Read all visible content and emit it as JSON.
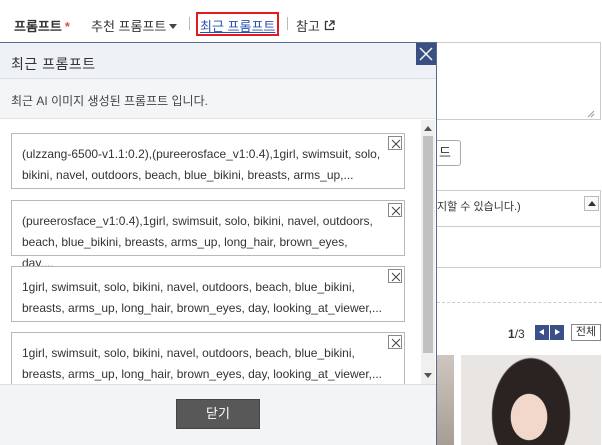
{
  "tabs": {
    "prompt": "프롬프트",
    "required_mark": "*",
    "recommended": "추천 프롬프트",
    "recent": "최근 프롬프트",
    "reference": "참고"
  },
  "background": {
    "button_label": "드",
    "notice_text": "지할 수 있습니다.)",
    "pager_current": "1",
    "pager_total": "/3",
    "all_label": "전체"
  },
  "modal": {
    "title": "최근 프롬프트",
    "description": "최근 AI 이미지 생성된 프롬프트 입니다.",
    "items": [
      {
        "text": "(ulzzang-6500-v1.1:0.2),(pureerosface_v1:0.4),1girl, swimsuit, solo, bikini, navel, outdoors, beach, blue_bikini, breasts, arms_up,..."
      },
      {
        "text": "(pureerosface_v1:0.4),1girl, swimsuit, solo, bikini, navel, outdoors, beach, blue_bikini, breasts, arms_up, long_hair, brown_eyes, day,..."
      },
      {
        "text": "1girl, swimsuit, solo, bikini, navel, outdoors, beach, blue_bikini, breasts, arms_up, long_hair, brown_eyes, day, looking_at_viewer,..."
      },
      {
        "text": "1girl, swimsuit, solo, bikini, navel, outdoors, beach, blue_bikini, breasts, arms_up, long_hair, brown_eyes, day, looking_at_viewer,..."
      }
    ],
    "close_label": "닫기"
  },
  "colors": {
    "highlight_border": "#e21c1c",
    "link": "#2a4fb5",
    "modal_close_bg": "#3a5080",
    "close_button_bg": "#585858"
  }
}
